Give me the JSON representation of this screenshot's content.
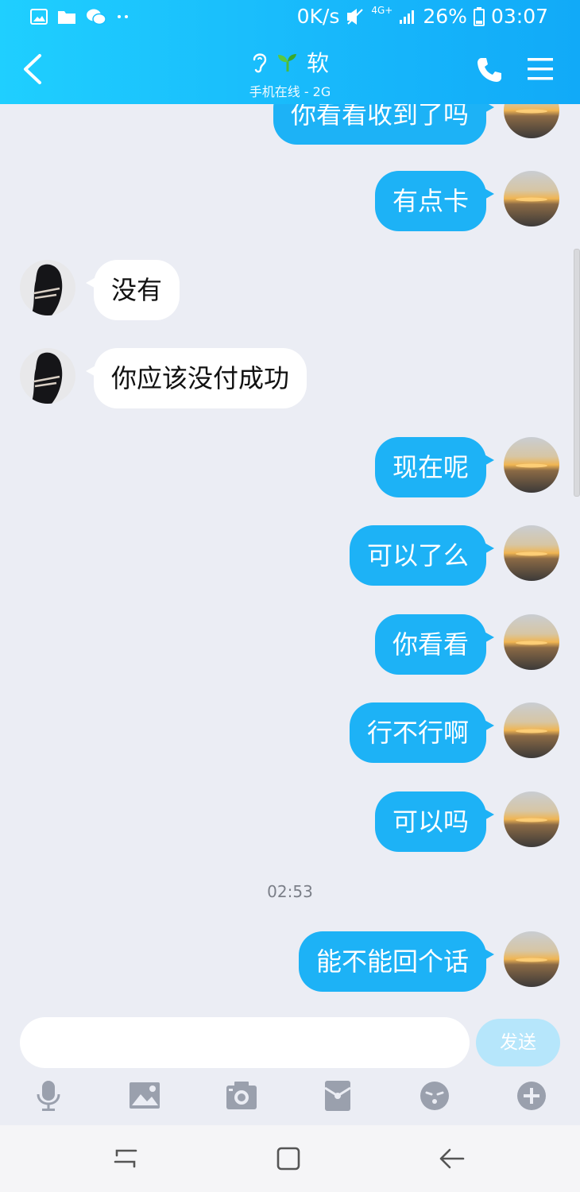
{
  "status_bar": {
    "speed": "0K/s",
    "network": "4G+",
    "battery": "26%",
    "time": "03:07"
  },
  "header": {
    "title": "软",
    "subtitle": "手机在线 - 2G"
  },
  "messages": [
    {
      "side": "out",
      "text": "你看看收到了吗"
    },
    {
      "side": "out",
      "text": "有点卡"
    },
    {
      "side": "in",
      "text": "没有"
    },
    {
      "side": "in",
      "text": "你应该没付成功"
    },
    {
      "side": "out",
      "text": "现在呢"
    },
    {
      "side": "out",
      "text": "可以了么"
    },
    {
      "side": "out",
      "text": "你看看"
    },
    {
      "side": "out",
      "text": "行不行啊"
    },
    {
      "side": "out",
      "text": "可以吗"
    },
    {
      "side": "out",
      "text": "能不能回个话"
    }
  ],
  "timestamp": "02:53",
  "input": {
    "placeholder": "",
    "send_label": "发送"
  },
  "toolbar_icons": [
    "microphone-icon",
    "image-icon",
    "camera-icon",
    "red-packet-icon",
    "emoji-icon",
    "plus-icon"
  ],
  "colors": {
    "header_start": "#1fcfff",
    "header_end": "#11aaf8",
    "outgoing_bubble": "#1db2f6",
    "incoming_bubble": "#ffffff",
    "background": "#ebedf4",
    "send_button": "#b6e6fb"
  }
}
